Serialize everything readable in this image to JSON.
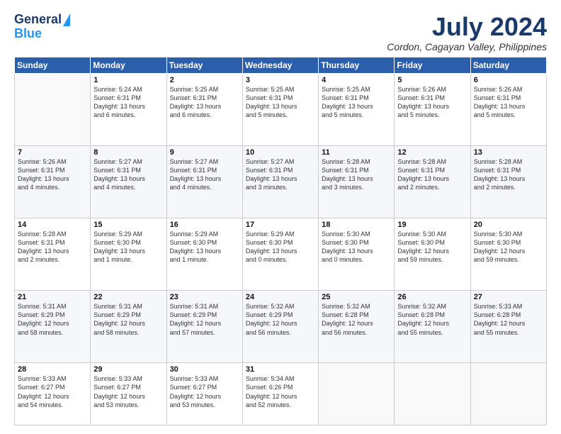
{
  "header": {
    "logo_line1": "General",
    "logo_line2": "Blue",
    "month_title": "July 2024",
    "location": "Cordon, Cagayan Valley, Philippines"
  },
  "weekdays": [
    "Sunday",
    "Monday",
    "Tuesday",
    "Wednesday",
    "Thursday",
    "Friday",
    "Saturday"
  ],
  "weeks": [
    [
      {
        "day": "",
        "info": ""
      },
      {
        "day": "1",
        "info": "Sunrise: 5:24 AM\nSunset: 6:31 PM\nDaylight: 13 hours\nand 6 minutes."
      },
      {
        "day": "2",
        "info": "Sunrise: 5:25 AM\nSunset: 6:31 PM\nDaylight: 13 hours\nand 6 minutes."
      },
      {
        "day": "3",
        "info": "Sunrise: 5:25 AM\nSunset: 6:31 PM\nDaylight: 13 hours\nand 5 minutes."
      },
      {
        "day": "4",
        "info": "Sunrise: 5:25 AM\nSunset: 6:31 PM\nDaylight: 13 hours\nand 5 minutes."
      },
      {
        "day": "5",
        "info": "Sunrise: 5:26 AM\nSunset: 6:31 PM\nDaylight: 13 hours\nand 5 minutes."
      },
      {
        "day": "6",
        "info": "Sunrise: 5:26 AM\nSunset: 6:31 PM\nDaylight: 13 hours\nand 5 minutes."
      }
    ],
    [
      {
        "day": "7",
        "info": "Sunrise: 5:26 AM\nSunset: 6:31 PM\nDaylight: 13 hours\nand 4 minutes."
      },
      {
        "day": "8",
        "info": "Sunrise: 5:27 AM\nSunset: 6:31 PM\nDaylight: 13 hours\nand 4 minutes."
      },
      {
        "day": "9",
        "info": "Sunrise: 5:27 AM\nSunset: 6:31 PM\nDaylight: 13 hours\nand 4 minutes."
      },
      {
        "day": "10",
        "info": "Sunrise: 5:27 AM\nSunset: 6:31 PM\nDaylight: 13 hours\nand 3 minutes."
      },
      {
        "day": "11",
        "info": "Sunrise: 5:28 AM\nSunset: 6:31 PM\nDaylight: 13 hours\nand 3 minutes."
      },
      {
        "day": "12",
        "info": "Sunrise: 5:28 AM\nSunset: 6:31 PM\nDaylight: 13 hours\nand 2 minutes."
      },
      {
        "day": "13",
        "info": "Sunrise: 5:28 AM\nSunset: 6:31 PM\nDaylight: 13 hours\nand 2 minutes."
      }
    ],
    [
      {
        "day": "14",
        "info": "Sunrise: 5:28 AM\nSunset: 6:31 PM\nDaylight: 13 hours\nand 2 minutes."
      },
      {
        "day": "15",
        "info": "Sunrise: 5:29 AM\nSunset: 6:30 PM\nDaylight: 13 hours\nand 1 minute."
      },
      {
        "day": "16",
        "info": "Sunrise: 5:29 AM\nSunset: 6:30 PM\nDaylight: 13 hours\nand 1 minute."
      },
      {
        "day": "17",
        "info": "Sunrise: 5:29 AM\nSunset: 6:30 PM\nDaylight: 13 hours\nand 0 minutes."
      },
      {
        "day": "18",
        "info": "Sunrise: 5:30 AM\nSunset: 6:30 PM\nDaylight: 13 hours\nand 0 minutes."
      },
      {
        "day": "19",
        "info": "Sunrise: 5:30 AM\nSunset: 6:30 PM\nDaylight: 12 hours\nand 59 minutes."
      },
      {
        "day": "20",
        "info": "Sunrise: 5:30 AM\nSunset: 6:30 PM\nDaylight: 12 hours\nand 59 minutes."
      }
    ],
    [
      {
        "day": "21",
        "info": "Sunrise: 5:31 AM\nSunset: 6:29 PM\nDaylight: 12 hours\nand 58 minutes."
      },
      {
        "day": "22",
        "info": "Sunrise: 5:31 AM\nSunset: 6:29 PM\nDaylight: 12 hours\nand 58 minutes."
      },
      {
        "day": "23",
        "info": "Sunrise: 5:31 AM\nSunset: 6:29 PM\nDaylight: 12 hours\nand 57 minutes."
      },
      {
        "day": "24",
        "info": "Sunrise: 5:32 AM\nSunset: 6:29 PM\nDaylight: 12 hours\nand 56 minutes."
      },
      {
        "day": "25",
        "info": "Sunrise: 5:32 AM\nSunset: 6:28 PM\nDaylight: 12 hours\nand 56 minutes."
      },
      {
        "day": "26",
        "info": "Sunrise: 5:32 AM\nSunset: 6:28 PM\nDaylight: 12 hours\nand 55 minutes."
      },
      {
        "day": "27",
        "info": "Sunrise: 5:33 AM\nSunset: 6:28 PM\nDaylight: 12 hours\nand 55 minutes."
      }
    ],
    [
      {
        "day": "28",
        "info": "Sunrise: 5:33 AM\nSunset: 6:27 PM\nDaylight: 12 hours\nand 54 minutes."
      },
      {
        "day": "29",
        "info": "Sunrise: 5:33 AM\nSunset: 6:27 PM\nDaylight: 12 hours\nand 53 minutes."
      },
      {
        "day": "30",
        "info": "Sunrise: 5:33 AM\nSunset: 6:27 PM\nDaylight: 12 hours\nand 53 minutes."
      },
      {
        "day": "31",
        "info": "Sunrise: 5:34 AM\nSunset: 6:26 PM\nDaylight: 12 hours\nand 52 minutes."
      },
      {
        "day": "",
        "info": ""
      },
      {
        "day": "",
        "info": ""
      },
      {
        "day": "",
        "info": ""
      }
    ]
  ]
}
